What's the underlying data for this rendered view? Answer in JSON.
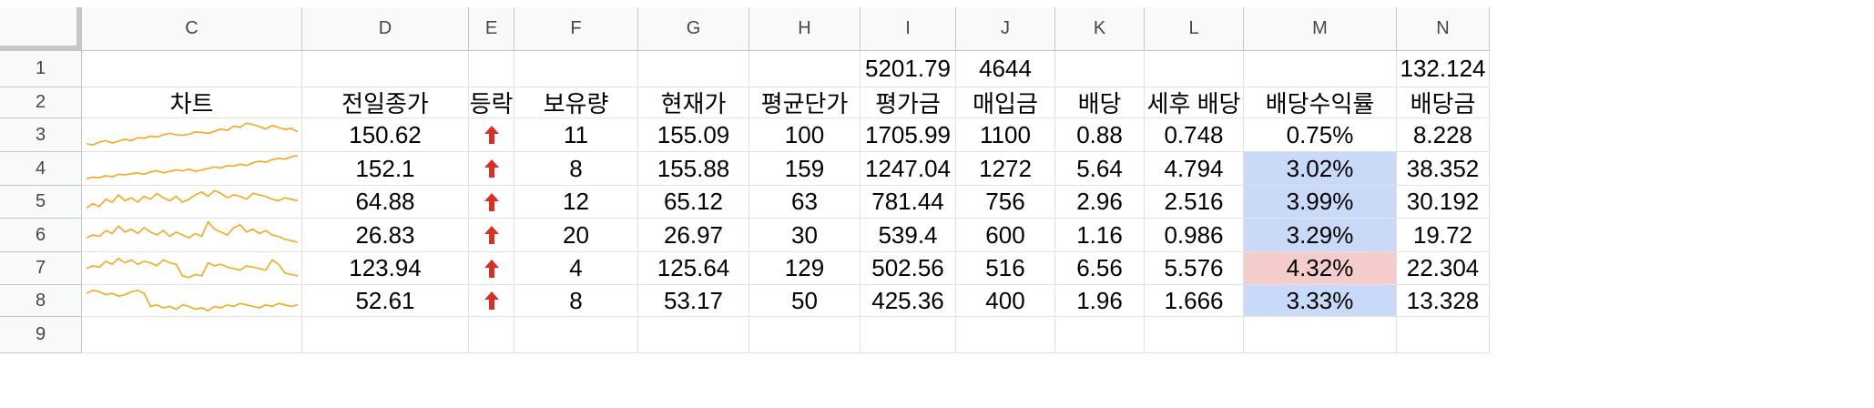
{
  "columns": [
    "C",
    "D",
    "E",
    "F",
    "G",
    "H",
    "I",
    "J",
    "K",
    "L",
    "M",
    "N"
  ],
  "rows": [
    "1",
    "2",
    "3",
    "4",
    "5",
    "6",
    "7",
    "8",
    "9"
  ],
  "row1": {
    "I": "5201.79",
    "J": "4644",
    "N": "132.124"
  },
  "headers": {
    "C": "차트",
    "D": "전일종가",
    "E": "등락",
    "F": "보유량",
    "G": "현재가",
    "H": "평균단가",
    "I": "평가금",
    "J": "매입금",
    "K": "배당",
    "L": "세후 배당",
    "M": "배당수익률",
    "N": "배당금"
  },
  "data_rows": [
    {
      "D": "150.62",
      "F": "11",
      "G": "155.09",
      "H": "100",
      "I": "1705.99",
      "J": "1100",
      "K": "0.88",
      "L": "0.748",
      "M": "0.75%",
      "N": "8.228",
      "highlight": "none",
      "spark": [
        0.2,
        0.15,
        0.25,
        0.3,
        0.22,
        0.28,
        0.35,
        0.3,
        0.4,
        0.38,
        0.45,
        0.42,
        0.5,
        0.55,
        0.5,
        0.48,
        0.52,
        0.6,
        0.58,
        0.55,
        0.62,
        0.7,
        0.65,
        0.8,
        0.75,
        0.9,
        0.85,
        0.78,
        0.7,
        0.82,
        0.75,
        0.68,
        0.72,
        0.6
      ]
    },
    {
      "D": "152.1",
      "F": "8",
      "G": "155.88",
      "H": "159",
      "I": "1247.04",
      "J": "1272",
      "K": "5.64",
      "L": "4.794",
      "M": "3.02%",
      "N": "38.352",
      "highlight": "blue",
      "spark": [
        0.15,
        0.2,
        0.18,
        0.25,
        0.22,
        0.3,
        0.28,
        0.32,
        0.35,
        0.3,
        0.38,
        0.42,
        0.35,
        0.4,
        0.45,
        0.42,
        0.48,
        0.4,
        0.45,
        0.5,
        0.55,
        0.52,
        0.6,
        0.58,
        0.65,
        0.6,
        0.7,
        0.75,
        0.72,
        0.8,
        0.85,
        0.82,
        0.9,
        0.95
      ]
    },
    {
      "D": "64.88",
      "F": "12",
      "G": "65.12",
      "H": "63",
      "I": "781.44",
      "J": "756",
      "K": "2.96",
      "L": "2.516",
      "M": "3.99%",
      "N": "30.192",
      "highlight": "blue",
      "spark": [
        0.3,
        0.45,
        0.35,
        0.6,
        0.5,
        0.75,
        0.55,
        0.65,
        0.5,
        0.7,
        0.6,
        0.8,
        0.65,
        0.55,
        0.7,
        0.5,
        0.6,
        0.75,
        0.85,
        0.7,
        0.9,
        0.8,
        0.65,
        0.75,
        0.7,
        0.6,
        0.8,
        0.75,
        0.7,
        0.6,
        0.55,
        0.65,
        0.6,
        0.55
      ]
    },
    {
      "D": "26.83",
      "F": "20",
      "G": "26.97",
      "H": "30",
      "I": "539.4",
      "J": "600",
      "K": "1.16",
      "L": "0.986",
      "M": "3.29%",
      "N": "19.72",
      "highlight": "blue",
      "spark": [
        0.4,
        0.5,
        0.45,
        0.65,
        0.55,
        0.8,
        0.6,
        0.7,
        0.55,
        0.75,
        0.6,
        0.5,
        0.65,
        0.45,
        0.6,
        0.5,
        0.4,
        0.55,
        0.45,
        0.95,
        0.7,
        0.6,
        0.5,
        0.75,
        0.85,
        0.6,
        0.7,
        0.55,
        0.65,
        0.5,
        0.45,
        0.35,
        0.3,
        0.25
      ]
    },
    {
      "D": "123.94",
      "F": "4",
      "G": "125.64",
      "H": "129",
      "I": "502.56",
      "J": "516",
      "K": "6.56",
      "L": "5.576",
      "M": "4.32%",
      "N": "22.304",
      "highlight": "red",
      "spark": [
        0.5,
        0.6,
        0.55,
        0.75,
        0.65,
        0.85,
        0.7,
        0.8,
        0.65,
        0.75,
        0.7,
        0.6,
        0.8,
        0.7,
        0.65,
        0.25,
        0.2,
        0.3,
        0.25,
        0.7,
        0.6,
        0.65,
        0.55,
        0.5,
        0.45,
        0.6,
        0.55,
        0.5,
        0.45,
        0.8,
        0.65,
        0.35,
        0.3,
        0.25
      ]
    },
    {
      "D": "52.61",
      "F": "8",
      "G": "53.17",
      "H": "50",
      "I": "425.36",
      "J": "400",
      "K": "1.96",
      "L": "1.666",
      "M": "3.33%",
      "N": "13.328",
      "highlight": "blue",
      "spark": [
        0.75,
        0.85,
        0.8,
        0.7,
        0.75,
        0.65,
        0.7,
        0.8,
        0.85,
        0.75,
        0.3,
        0.35,
        0.25,
        0.3,
        0.2,
        0.35,
        0.3,
        0.2,
        0.25,
        0.15,
        0.3,
        0.25,
        0.35,
        0.3,
        0.4,
        0.35,
        0.3,
        0.25,
        0.35,
        0.3,
        0.4,
        0.35,
        0.3,
        0.35
      ]
    }
  ],
  "colors": {
    "header_bg": "#f8f9fa",
    "grid": "#e1e1e1",
    "header_border": "#c4c7c5",
    "spark": "#f4a81d",
    "arrow_up": "#d93025",
    "highlight_blue": "#c9daf8",
    "highlight_red": "#f4cccc"
  },
  "icons": {
    "change": "arrow-up-icon"
  }
}
